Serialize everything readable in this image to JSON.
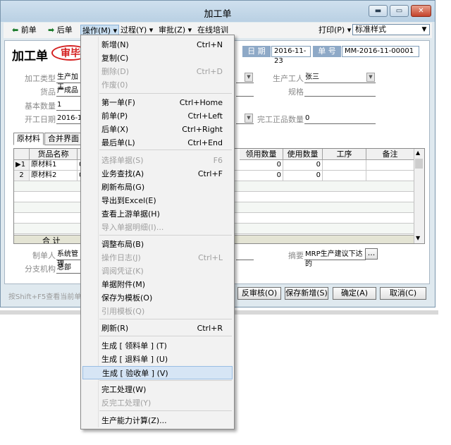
{
  "window": {
    "title": "加工单",
    "controls": {
      "minimize": "▬",
      "restore": "▭",
      "close": "✕"
    }
  },
  "toolbar": {
    "prev_arrow": "⬅",
    "prev": "前单",
    "next_arrow": "➡",
    "next": "后单",
    "operations": "操作(M) ▾",
    "process": "过程(Y) ▾",
    "approve": "审批(Z) ▾",
    "training": "在线培训",
    "print": "打印(P) ▾",
    "style_value": "标准样式"
  },
  "form": {
    "doc_title": "加工单",
    "stamp": "审毕",
    "date_label": "日 期",
    "date_value": "2016-11-23",
    "number_label": "单 号",
    "number_value": "MM-2016-11-00001",
    "fields": {
      "process_type_label": "加工类型",
      "process_type_value": "生产加工",
      "product_label": "货品",
      "product_value": "产成品",
      "base_qty_label": "基本数量",
      "base_qty_value": "1",
      "start_date_label": "开工日期",
      "start_date_value": "2016-1",
      "worker_label": "生产工人",
      "worker_value": "张三",
      "spec_label": "规格",
      "spec_value": "",
      "finished_qty_label": "完工正品数量",
      "finished_qty_value": "0"
    },
    "tabs": {
      "materials": "原材料",
      "merge": "合并界面"
    },
    "grid": {
      "headers": {
        "name": "货品名称",
        "code": "",
        "get_qty": "领用数量",
        "use_qty": "使用数量",
        "process": "工序",
        "remark": "备注"
      },
      "rows": [
        {
          "idx": "1",
          "marker": "▶",
          "name": "原材料1",
          "code": "0",
          "get_qty": "0",
          "use_qty": "0"
        },
        {
          "idx": "2",
          "marker": "",
          "name": "原材料2",
          "code": "0",
          "get_qty": "0",
          "use_qty": "0"
        }
      ],
      "total": "合 计"
    },
    "footer": {
      "maker_label": "制单人",
      "maker_value": "系统管理",
      "branch_label": "分支机构",
      "branch_value": "总部",
      "summary_label": "摘要",
      "summary_value": "MRP生产建议下达的",
      "summary_btn": "..."
    }
  },
  "statusbar": {
    "hint": "按Shift+F5查看当前单",
    "unapprove": "反审核(O)",
    "save_new": "保存新增(S)",
    "ok": "确定(A)",
    "cancel": "取消(C)"
  },
  "menu": {
    "items": [
      {
        "label": "新增(N)",
        "shortcut": "Ctrl+N",
        "disabled": false
      },
      {
        "label": "复制(C)",
        "shortcut": "",
        "disabled": false
      },
      {
        "label": "删除(D)",
        "shortcut": "Ctrl+D",
        "disabled": true
      },
      {
        "label": "作废(0)",
        "shortcut": "",
        "disabled": true
      },
      {
        "label": "第一单(F)",
        "shortcut": "Ctrl+Home",
        "disabled": false
      },
      {
        "label": "前单(P)",
        "shortcut": "Ctrl+Left",
        "disabled": false
      },
      {
        "label": "后单(X)",
        "shortcut": "Ctrl+Right",
        "disabled": false
      },
      {
        "label": "最后单(L)",
        "shortcut": "Ctrl+End",
        "disabled": false
      },
      {
        "label": "选择单据(S)",
        "shortcut": "F6",
        "disabled": true
      },
      {
        "label": "业务查找(A)",
        "shortcut": "Ctrl+F",
        "disabled": false
      },
      {
        "label": "刷新布局(G)",
        "shortcut": "",
        "disabled": false
      },
      {
        "label": "导出到Excel(E)",
        "shortcut": "",
        "disabled": false
      },
      {
        "label": "查看上游单据(H)",
        "shortcut": "",
        "disabled": false
      },
      {
        "label": "导入单据明细(I)...",
        "shortcut": "",
        "disabled": true
      },
      {
        "label": "调整布局(B)",
        "shortcut": "",
        "disabled": false
      },
      {
        "label": "操作日志(J)",
        "shortcut": "Ctrl+L",
        "disabled": true
      },
      {
        "label": "调阅凭证(K)",
        "shortcut": "",
        "disabled": true
      },
      {
        "label": "单据附件(M)",
        "shortcut": "",
        "disabled": false
      },
      {
        "label": "保存为模板(O)",
        "shortcut": "",
        "disabled": false
      },
      {
        "label": "引用模板(Q)",
        "shortcut": "",
        "disabled": true
      },
      {
        "label": "刷新(R)",
        "shortcut": "Ctrl+R",
        "disabled": false
      },
      {
        "label": "生成 [ 领料单 ] (T)",
        "shortcut": "",
        "disabled": false
      },
      {
        "label": "生成 [ 退料单 ] (U)",
        "shortcut": "",
        "disabled": false
      },
      {
        "label": "生成 [ 验收单 ] (V)",
        "shortcut": "",
        "disabled": false,
        "highlighted": true
      },
      {
        "label": "完工处理(W)",
        "shortcut": "",
        "disabled": false
      },
      {
        "label": "反完工处理(Y)",
        "shortcut": "",
        "disabled": true
      },
      {
        "label": "生产能力计算(Z)...",
        "shortcut": "",
        "disabled": false
      }
    ]
  }
}
